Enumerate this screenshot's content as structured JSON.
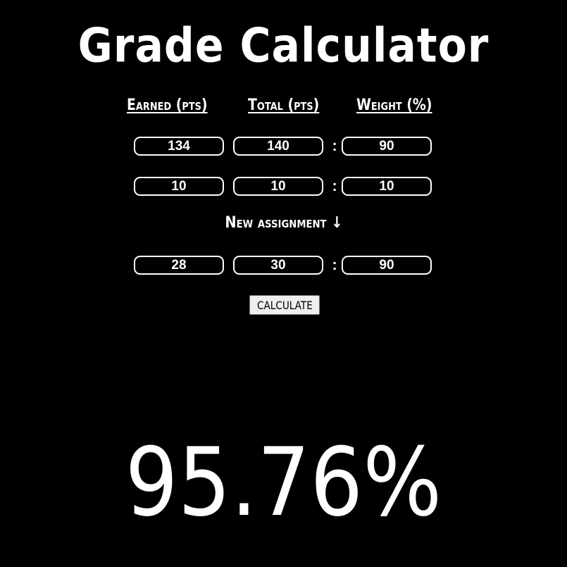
{
  "title": "Grade Calculator",
  "headers": {
    "earned": "Earned (pts)",
    "total": "Total (pts)",
    "weight": "Weight (%)"
  },
  "separator": ":",
  "rows": [
    {
      "earned": "134",
      "total": "140",
      "weight": "90"
    },
    {
      "earned": "10",
      "total": "10",
      "weight": "10"
    }
  ],
  "new_assignment": {
    "label": "New assignment ↓",
    "earned": "28",
    "total": "30",
    "weight": "90"
  },
  "calculate_label": "CALCULATE",
  "result": "95.76%",
  "colors": {
    "background": "#000000",
    "foreground": "#ffffff",
    "button_bg": "#efefef"
  }
}
